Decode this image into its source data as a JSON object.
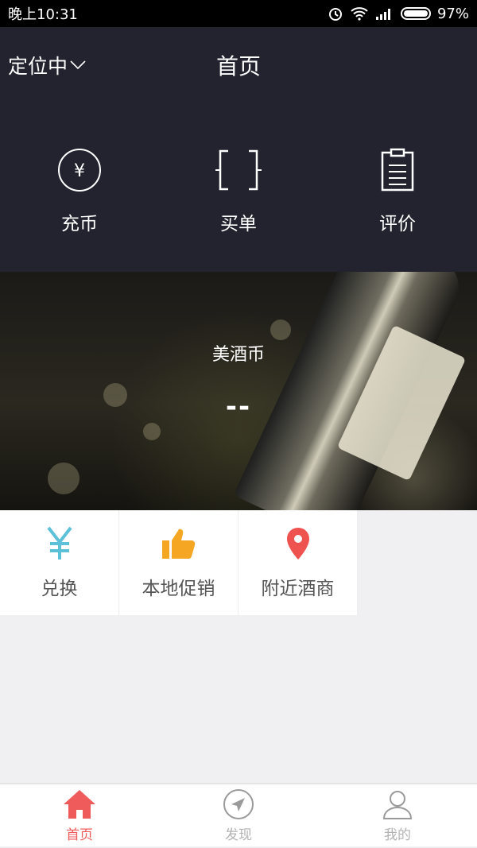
{
  "status_bar": {
    "time": "晚上10:31",
    "battery": "97%"
  },
  "header": {
    "location": "定位中",
    "title": "首页",
    "actions": [
      {
        "label": "充币",
        "icon": "yen-circle-icon"
      },
      {
        "label": "买单",
        "icon": "scan-icon"
      },
      {
        "label": "评价",
        "icon": "clipboard-icon"
      }
    ]
  },
  "banner": {
    "title": "美酒币",
    "value": "--"
  },
  "features": [
    {
      "label": "兑换",
      "icon": "yen-icon",
      "color": "#5bc0d8"
    },
    {
      "label": "本地促销",
      "icon": "thumbs-up-icon",
      "color": "#f5a623"
    },
    {
      "label": "附近酒商",
      "icon": "map-pin-icon",
      "color": "#ef5350"
    }
  ],
  "bottom_nav": [
    {
      "label": "首页",
      "icon": "home-icon",
      "active": true
    },
    {
      "label": "发现",
      "icon": "compass-icon",
      "active": false
    },
    {
      "label": "我的",
      "icon": "user-icon",
      "active": false
    }
  ],
  "colors": {
    "header_bg": "#22232e",
    "accent": "#ef5b5b"
  }
}
